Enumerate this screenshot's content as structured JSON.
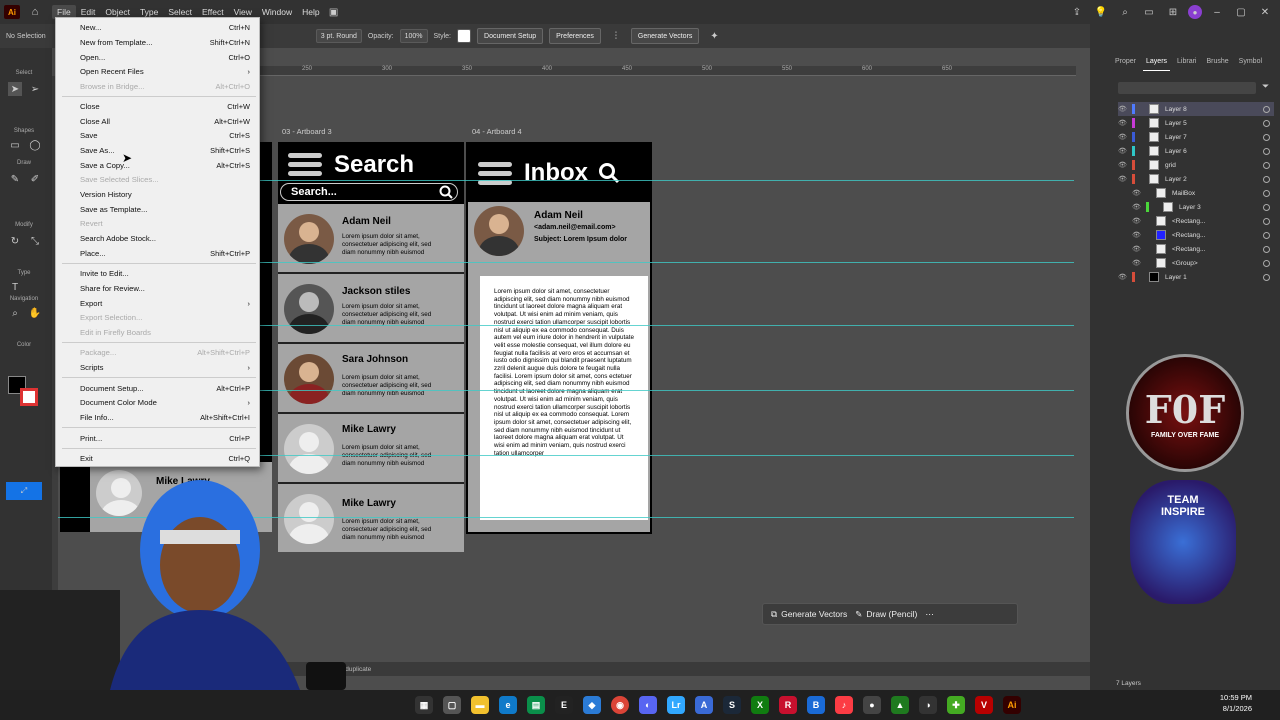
{
  "menubar": {
    "logo": "Ai",
    "items": [
      "File",
      "Edit",
      "Object",
      "Type",
      "Select",
      "Effect",
      "View",
      "Window",
      "Help"
    ]
  },
  "controlbar": {
    "selection": "No Selection",
    "stroke": "3 pt. Round",
    "opacity_label": "Opacity:",
    "opacity": "100%",
    "style_label": "Style:",
    "document_setup": "Document Setup",
    "preferences": "Preferences",
    "generate_vectors": "Generate Vectors"
  },
  "tools": {
    "select": "Select",
    "shapes": "Shapes",
    "draw": "Draw",
    "modify": "Modify",
    "type": "Type",
    "navigation": "Navigation",
    "color": "Color"
  },
  "ruler": [
    "250",
    "300",
    "350",
    "400",
    "450",
    "500",
    "550",
    "600",
    "650"
  ],
  "file_menu": {
    "items": [
      {
        "label": "New...",
        "shortcut": "Ctrl+N",
        "disabled": false
      },
      {
        "label": "New from Template...",
        "shortcut": "Shift+Ctrl+N",
        "disabled": false
      },
      {
        "label": "Open...",
        "shortcut": "Ctrl+O",
        "disabled": false
      },
      {
        "label": "Open Recent Files",
        "shortcut": "",
        "disabled": false,
        "submenu": true
      },
      {
        "label": "Browse in Bridge...",
        "shortcut": "Alt+Ctrl+O",
        "disabled": true
      },
      {
        "label": "Close",
        "shortcut": "Ctrl+W",
        "disabled": false
      },
      {
        "label": "Close All",
        "shortcut": "Alt+Ctrl+W",
        "disabled": false
      },
      {
        "label": "Save",
        "shortcut": "Ctrl+S",
        "disabled": false
      },
      {
        "label": "Save As...",
        "shortcut": "Shift+Ctrl+S",
        "disabled": false
      },
      {
        "label": "Save a Copy...",
        "shortcut": "Alt+Ctrl+S",
        "disabled": false
      },
      {
        "label": "Save Selected Slices...",
        "shortcut": "",
        "disabled": true
      },
      {
        "label": "Version History",
        "shortcut": "",
        "disabled": false
      },
      {
        "label": "Save as Template...",
        "shortcut": "",
        "disabled": false
      },
      {
        "label": "Revert",
        "shortcut": "",
        "disabled": true
      },
      {
        "label": "Search Adobe Stock...",
        "shortcut": "",
        "disabled": false
      },
      {
        "label": "Place...",
        "shortcut": "Shift+Ctrl+P",
        "disabled": false
      },
      {
        "label": "Invite to Edit...",
        "shortcut": "",
        "disabled": false
      },
      {
        "label": "Share for Review...",
        "shortcut": "",
        "disabled": false
      },
      {
        "label": "Export",
        "shortcut": "",
        "disabled": false,
        "submenu": true
      },
      {
        "label": "Export Selection...",
        "shortcut": "",
        "disabled": true
      },
      {
        "label": "Edit in Firefly Boards",
        "shortcut": "",
        "disabled": true
      },
      {
        "label": "Package...",
        "shortcut": "Alt+Shift+Ctrl+P",
        "disabled": true
      },
      {
        "label": "Scripts",
        "shortcut": "",
        "disabled": false,
        "submenu": true
      },
      {
        "label": "Document Setup...",
        "shortcut": "Alt+Ctrl+P",
        "disabled": false
      },
      {
        "label": "Document Color Mode",
        "shortcut": "",
        "disabled": false,
        "submenu": true
      },
      {
        "label": "File Info...",
        "shortcut": "Alt+Shift+Ctrl+I",
        "disabled": false
      },
      {
        "label": "Print...",
        "shortcut": "Ctrl+P",
        "disabled": false
      },
      {
        "label": "Exit",
        "shortcut": "Ctrl+Q",
        "disabled": false
      }
    ]
  },
  "artboard3": {
    "title": "03 - Artboard 3",
    "heading": "Search",
    "search_placeholder": "Search...",
    "contacts": [
      {
        "name": "Adam Neil",
        "text": "Lorem ipsum dolor sit amet, consectetuer adipiscing elit, sed diam nonummy nibh euismod"
      },
      {
        "name": "Jackson stiles",
        "text": "Lorem ipsum dolor sit amet, consectetuer adipiscing elit, sed diam nonummy nibh euismod"
      },
      {
        "name": "Sara Johnson",
        "text": "Lorem ipsum dolor sit amet, consectetuer adipiscing elit, sed diam nonummy nibh euismod"
      },
      {
        "name": "Mike Lawry",
        "text": "Lorem ipsum dolor sit amet, consectetuer adipiscing elit, sed diam nonummy nibh euismod"
      },
      {
        "name": "Mike Lawry",
        "text": "Lorem ipsum dolor sit amet, consectetuer adipiscing elit, sed diam nonummy nibh euismod"
      }
    ]
  },
  "artboard2": {
    "contact_name": "Mike Lawry"
  },
  "artboard4": {
    "title": "04 - Artboard 4",
    "heading": "Inbox",
    "sender_name": "Adam Neil",
    "sender_email": "<adam.neil@email.com>",
    "subject": "Subject: Lorem Ipsum dolor",
    "body": "Lorem ipsum dolor sit amet, consectetuer adipiscing elit, sed diam nonummy nibh euismod tincidunt ut laoreet dolore magna aliquam erat volutpat. Ut wisi enim ad minim veniam, quis nostrud exerci tation ullamcorper suscipit lobortis nisl ut aliquip ex ea commodo consequat. Duis autem vel eum iriure dolor in hendrerit in vulputate velit esse molestie consequat, vel illum dolore eu feugiat nulla facilisis at vero eros et accumsan et iusto odio dignissim qui blandit praesent luptatum zzril delenit augue duis dolore te feugait nulla facilisi. Lorem ipsum dolor sit amet, cons ectetuer adipiscing elit, sed diam nonummy nibh euismod tincidunt ut laoreet dolore magna aliquam erat volutpat. Ut wisi enim ad minim veniam, quis nostrud exerci tation ullamcorper suscipit lobortis nisl ut aliquip ex ea commodo consequat. Lorem ipsum dolor sit amet, consectetuer adipiscing elit, sed diam nonummy nibh euismod tincidunt ut laoreet dolore magna aliquam erat volutpat. Ut wisi enim ad minim veniam, quis nostrud exerci tation ullamcorper"
  },
  "panel": {
    "tabs": [
      "Proper",
      "Layers",
      "Librari",
      "Brushe",
      "Symbol"
    ],
    "layers": [
      {
        "name": "Layer 8",
        "color": "#4f7bff"
      },
      {
        "name": "Layer 5",
        "color": "#c83ad6"
      },
      {
        "name": "Layer 7",
        "color": "#3a5bd6"
      },
      {
        "name": "Layer 6",
        "color": "#2fc7c7"
      },
      {
        "name": "grid",
        "color": "#d64d3a"
      },
      {
        "name": "Layer 2",
        "color": "#d64d3a"
      },
      {
        "name": "MailBox",
        "color": "#d64d3a"
      },
      {
        "name": "Layer 3",
        "color": "#4ad63a"
      },
      {
        "name": "<Rectang...",
        "color": "#d64d3a"
      },
      {
        "name": "<Rectang...",
        "color": "#d64d3a"
      },
      {
        "name": "<Rectang...",
        "color": "#d64d3a"
      },
      {
        "name": "<Group>",
        "color": "#d64d3a"
      },
      {
        "name": "Layer 1",
        "color": "#d64d3a"
      }
    ],
    "layer_count": "7 Layers"
  },
  "floating_bar": {
    "generate": "Generate Vectors",
    "draw": "Draw (Pencil)"
  },
  "status": {
    "hint": "the object to duplicate"
  },
  "logos": {
    "fof_text": "FAMILY OVER FAME",
    "team_text": "TEAM INSPIRE"
  },
  "taskbar": {
    "time": "10:59 PM",
    "date": "8/1/2026"
  }
}
